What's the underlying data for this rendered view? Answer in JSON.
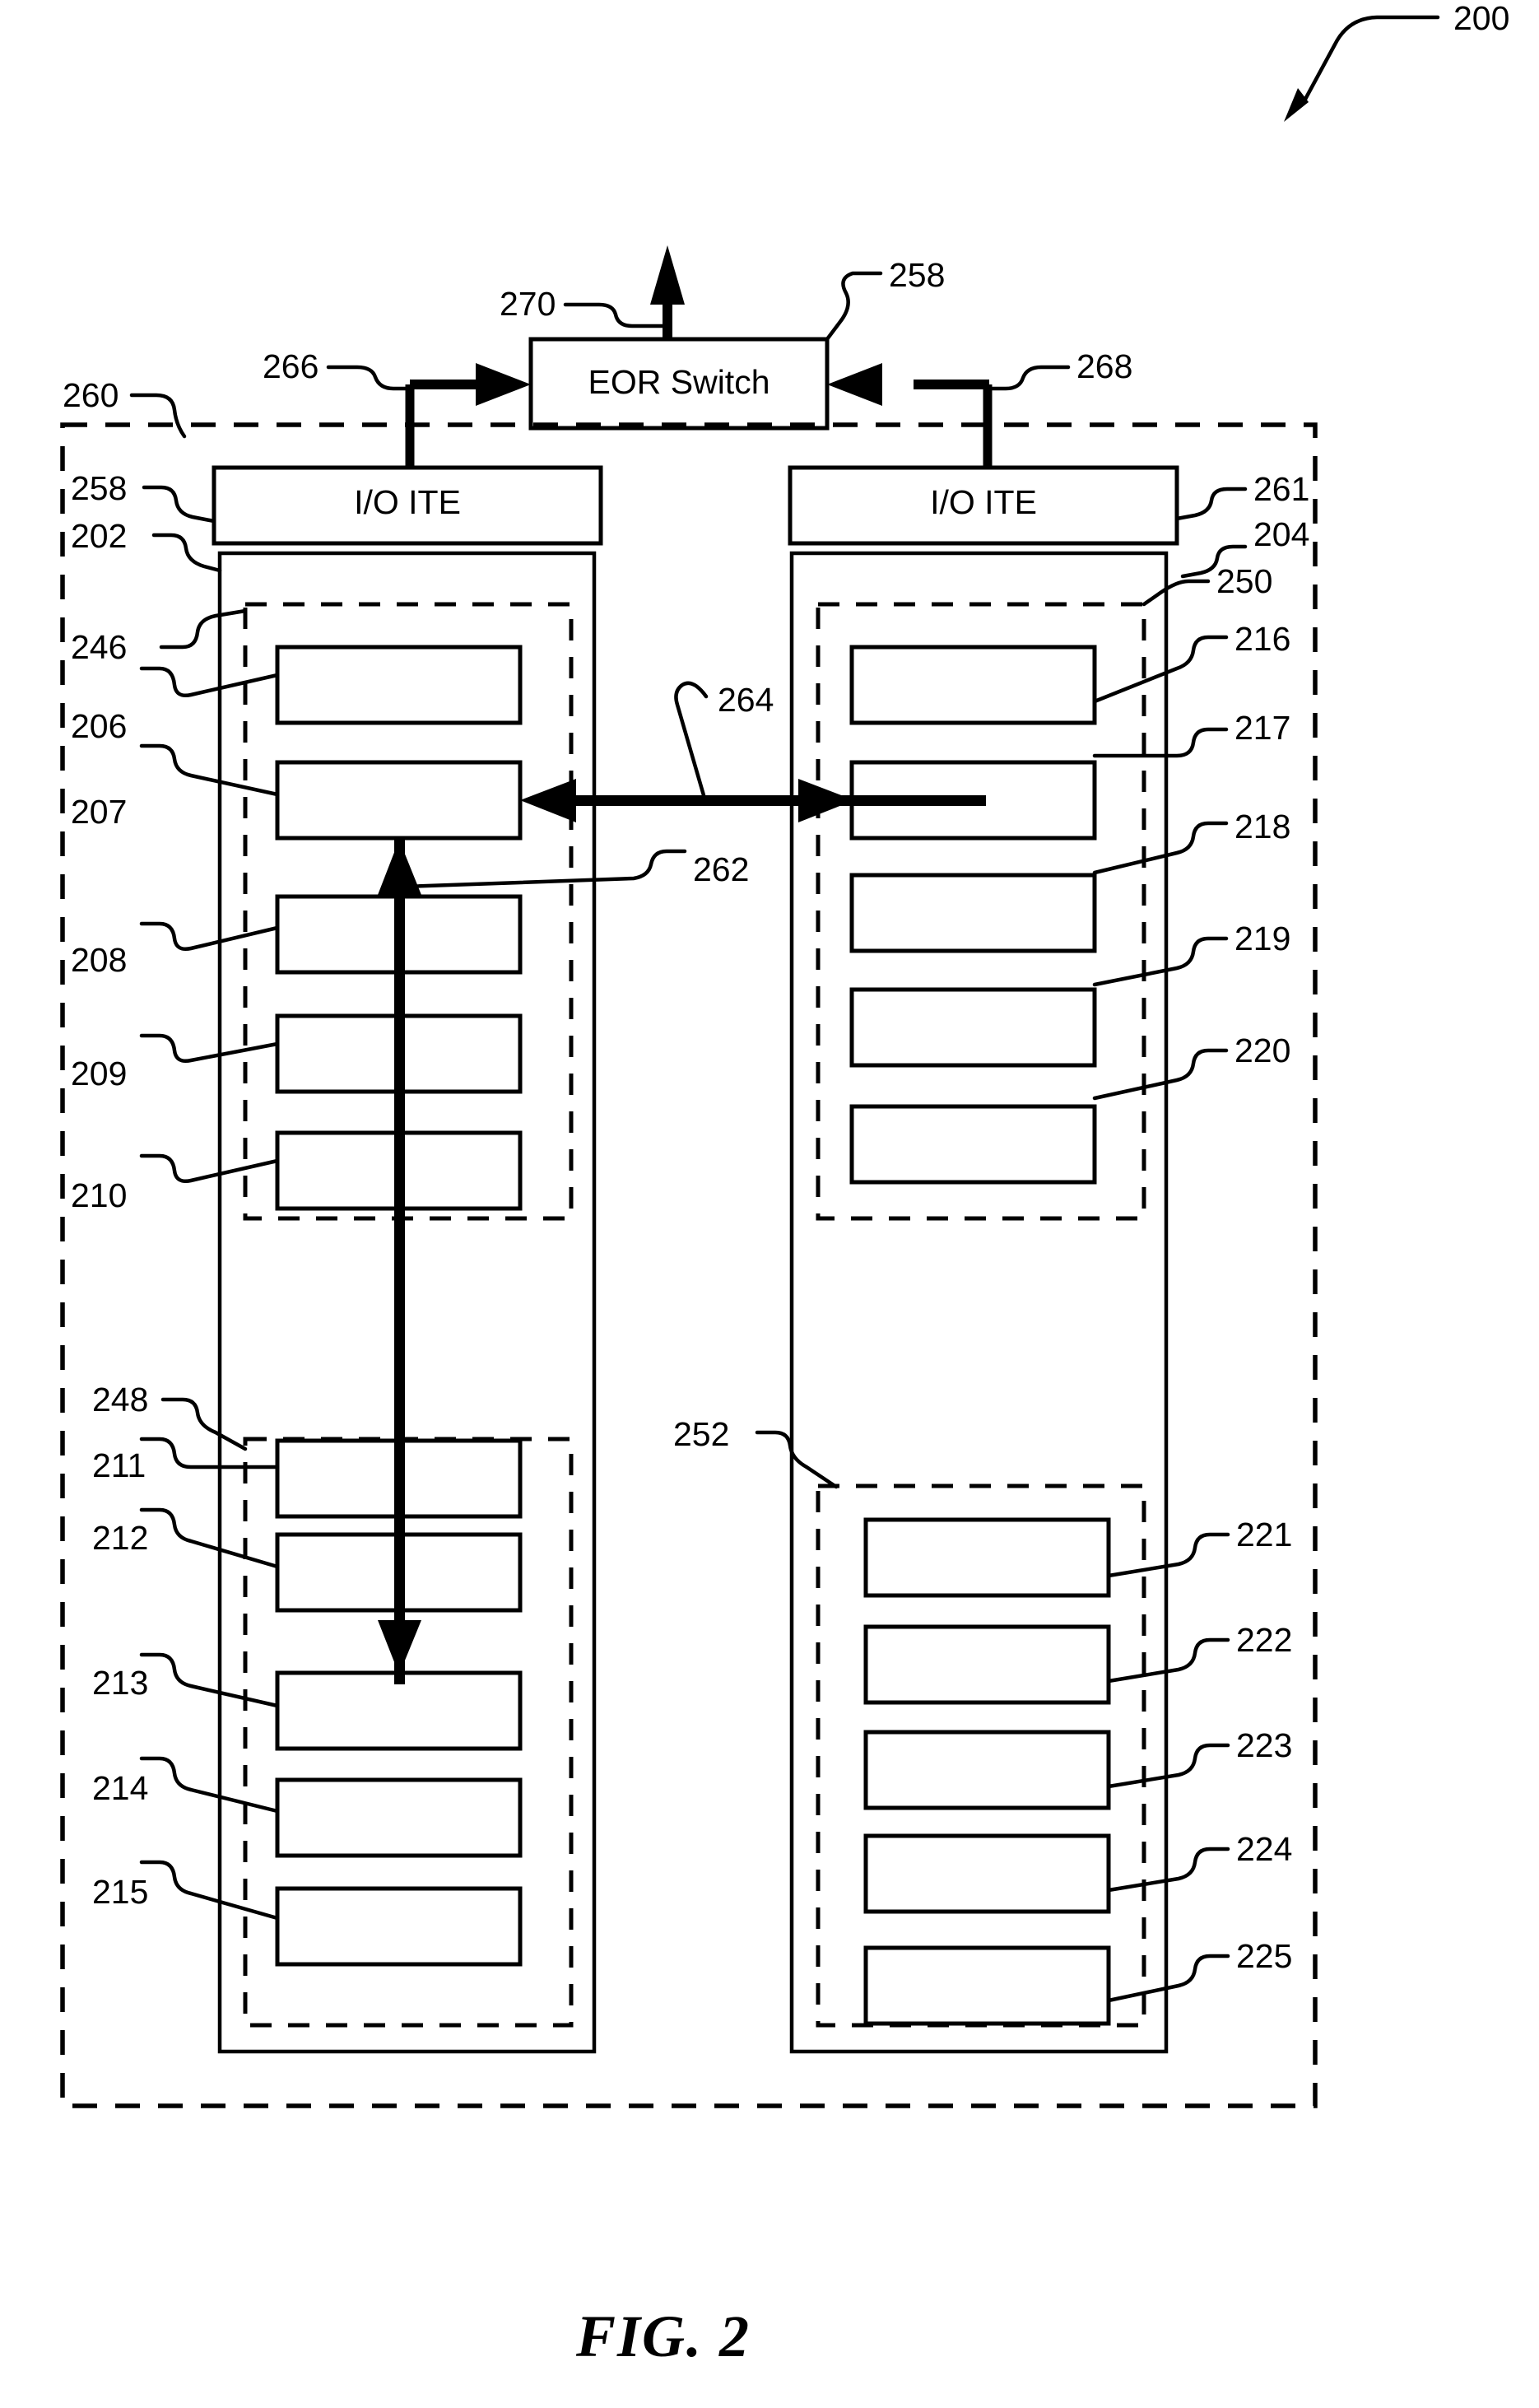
{
  "figure": {
    "caption": "FIG. 2",
    "overall_ref": "200"
  },
  "eor_switch": {
    "label": "EOR Switch",
    "ref": "258",
    "uplink_ref": "270",
    "left_link_ref": "266",
    "right_link_ref": "268"
  },
  "rack": {
    "ref": "260"
  },
  "io_ite_left": {
    "label": "I/O ITE",
    "ref_top": "258",
    "ref_bottom": "202"
  },
  "io_ite_right": {
    "label": "I/O ITE",
    "ref_top": "261",
    "ref_bottom": "204"
  },
  "left_chassis": {
    "ref": "202",
    "groups": [
      {
        "ref": "246",
        "items": [
          {
            "ref": "206"
          },
          {
            "ref": "207"
          },
          {
            "ref": "208"
          },
          {
            "ref": "209"
          },
          {
            "ref": "210"
          }
        ]
      },
      {
        "ref": "248",
        "items": [
          {
            "ref": "211"
          },
          {
            "ref": "212"
          },
          {
            "ref": "213"
          },
          {
            "ref": "214"
          },
          {
            "ref": "215"
          }
        ]
      }
    ]
  },
  "right_chassis": {
    "ref": "204",
    "groups": [
      {
        "ref": "250",
        "items": [
          {
            "ref": "216"
          },
          {
            "ref": "217"
          },
          {
            "ref": "218"
          },
          {
            "ref": "219"
          },
          {
            "ref": "220"
          }
        ]
      },
      {
        "ref": "252",
        "items": [
          {
            "ref": "221"
          },
          {
            "ref": "222"
          },
          {
            "ref": "223"
          },
          {
            "ref": "224"
          },
          {
            "ref": "225"
          }
        ]
      }
    ]
  },
  "interconnects": {
    "vertical_intra_chassis_ref": "262",
    "horizontal_inter_chassis_ref": "264"
  },
  "colors": {
    "ink": "#000000",
    "paper": "#ffffff"
  }
}
